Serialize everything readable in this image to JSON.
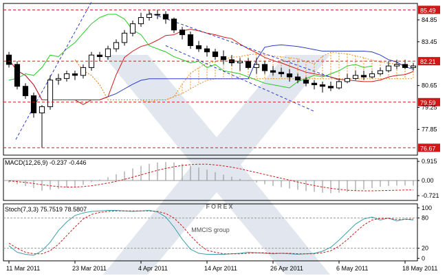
{
  "watermark": {
    "brand": "FOREX",
    "sub": "MMCIS group",
    "color": "#c8d2e2"
  },
  "colors": {
    "bull_candle": "#ffffff",
    "bear_candle": "#000000",
    "kijun": "#d01818",
    "tenkan": "#2a3cc8",
    "chikou": "#22cc22",
    "cloud": "#e88a1a",
    "cloud_bear": "#9a9a9a",
    "trend": "#2a3cc8",
    "level": "#d01818",
    "level_label_bg": "#d01818",
    "macd_hist": "#8c8c8c",
    "macd_signal": "#d01818",
    "stoch_main": "#3aa0a8",
    "stoch_signal": "#d01818"
  },
  "chart_data": [
    {
      "type": "candlestick",
      "panel": "price",
      "x": [
        "11 Mar 2011",
        "14 Mar 2011",
        "15 Mar 2011",
        "16 Mar 2011",
        "17 Mar 2011",
        "18 Mar 2011",
        "21 Mar 2011",
        "22 Mar 2011",
        "23 Mar 2011",
        "24 Mar 2011",
        "25 Mar 2011",
        "28 Mar 2011",
        "29 Mar 2011",
        "30 Mar 2011",
        "31 Mar 2011",
        "1 Apr 2011",
        "4 Apr 2011",
        "5 Apr 2011",
        "6 Apr 2011",
        "7 Apr 2011",
        "8 Apr 2011",
        "11 Apr 2011",
        "12 Apr 2011",
        "13 Apr 2011",
        "14 Apr 2011",
        "15 Apr 2011",
        "18 Apr 2011",
        "19 Apr 2011",
        "20 Apr 2011",
        "21 Apr 2011",
        "22 Apr 2011",
        "25 Apr 2011",
        "26 Apr 2011",
        "27 Apr 2011",
        "28 Apr 2011",
        "29 Apr 2011",
        "2 May 2011",
        "3 May 2011",
        "4 May 2011",
        "5 May 2011",
        "6 May 2011",
        "9 May 2011",
        "10 May 2011",
        "11 May 2011",
        "12 May 2011",
        "13 May 2011",
        "16 May 2011",
        "17 May 2011",
        "18 May 2011",
        "19 May 2011"
      ],
      "open": [
        82.6,
        82.0,
        80.6,
        80.0,
        78.9,
        79.3,
        81.0,
        81.1,
        81.4,
        81.3,
        81.8,
        82.6,
        82.5,
        83.0,
        83.4,
        84.0,
        84.6,
        85.0,
        85.2,
        85.2,
        84.9,
        84.2,
        83.9,
        83.2,
        83.0,
        82.8,
        82.5,
        82.3,
        82.1,
        82.2,
        81.8,
        82.0,
        81.6,
        81.5,
        81.4,
        81.2,
        81.0,
        80.8,
        80.7,
        80.6,
        80.5,
        80.9,
        81.1,
        81.3,
        81.2,
        81.4,
        81.6,
        81.9,
        82.0,
        81.8
      ],
      "high": [
        82.8,
        82.2,
        80.8,
        80.2,
        79.4,
        81.3,
        81.4,
        81.6,
        81.6,
        82.0,
        82.8,
        82.8,
        83.2,
        83.6,
        84.2,
        84.8,
        85.3,
        85.49,
        85.5,
        85.4,
        85.0,
        84.4,
        84.1,
        83.5,
        83.2,
        83.0,
        82.9,
        82.6,
        82.4,
        82.4,
        82.4,
        82.2,
        81.9,
        81.8,
        81.7,
        81.4,
        81.2,
        81.0,
        80.9,
        80.9,
        81.1,
        81.4,
        81.6,
        81.6,
        81.6,
        81.8,
        82.2,
        82.3,
        82.3,
        82.1
      ],
      "low": [
        81.8,
        80.4,
        79.8,
        78.6,
        76.67,
        79.1,
        80.7,
        80.9,
        81.0,
        81.1,
        81.6,
        82.2,
        82.3,
        82.8,
        83.2,
        83.8,
        84.4,
        84.8,
        84.9,
        84.6,
        84.0,
        83.6,
        83.0,
        82.8,
        82.5,
        82.3,
        82.0,
        81.9,
        81.6,
        81.7,
        81.4,
        81.4,
        81.3,
        81.2,
        80.9,
        80.8,
        80.6,
        80.4,
        80.2,
        80.3,
        80.4,
        80.8,
        81.0,
        81.0,
        81.1,
        81.3,
        81.5,
        81.7,
        81.7,
        81.6
      ],
      "close": [
        82.0,
        80.6,
        80.0,
        78.9,
        79.3,
        81.0,
        81.1,
        81.4,
        81.3,
        81.8,
        82.6,
        82.5,
        83.0,
        83.4,
        84.0,
        84.6,
        85.0,
        85.2,
        85.2,
        84.9,
        84.2,
        83.9,
        83.2,
        83.0,
        82.8,
        82.5,
        82.3,
        82.1,
        82.2,
        81.8,
        82.0,
        81.6,
        81.5,
        81.4,
        81.2,
        81.0,
        80.8,
        80.7,
        80.6,
        80.5,
        80.9,
        81.1,
        81.3,
        81.2,
        81.4,
        81.6,
        81.9,
        82.0,
        81.8,
        81.9
      ],
      "ylim": [
        76.2,
        85.9
      ],
      "y_ticks": [
        "84.85",
        "83.45",
        "82.21",
        "80.65",
        "79.25",
        "77.85"
      ],
      "y_tick_values": [
        84.85,
        83.45,
        82.21,
        80.65,
        79.25,
        77.85
      ],
      "levels": [
        {
          "value": 85.49,
          "label": "85.49"
        },
        {
          "value": 82.21,
          "label": "82.21"
        },
        {
          "value": 79.59,
          "label": "79.59"
        },
        {
          "value": 76.67,
          "label": "76.67"
        }
      ],
      "x_ticks": [
        "11 Mar 2011",
        "23 Mar 2011",
        "4 Apr 2011",
        "14 Apr 2011",
        "26 Apr 2011",
        "6 May 2011",
        "18 May 2011"
      ],
      "x_tick_index": [
        0,
        8,
        16,
        24,
        32,
        40,
        48
      ]
    },
    {
      "type": "line",
      "panel": "macd",
      "title": "MACD(12,26,9) -0.237 -0.446",
      "ylim": [
        -0.95,
        1.05
      ],
      "y_ticks": [
        "0.915",
        "0.00",
        "-0.721"
      ],
      "y_tick_values": [
        0.915,
        0.0,
        -0.721
      ],
      "histogram": [
        -0.1,
        -0.18,
        -0.26,
        -0.36,
        -0.48,
        -0.44,
        -0.4,
        -0.34,
        -0.28,
        -0.2,
        -0.08,
        0.04,
        0.16,
        0.3,
        0.44,
        0.58,
        0.7,
        0.8,
        0.86,
        0.88,
        0.86,
        0.8,
        0.72,
        0.62,
        0.52,
        0.4,
        0.28,
        0.18,
        0.08,
        -0.02,
        -0.1,
        -0.18,
        -0.26,
        -0.32,
        -0.38,
        -0.44,
        -0.5,
        -0.54,
        -0.58,
        -0.6,
        -0.58,
        -0.54,
        -0.48,
        -0.42,
        -0.36,
        -0.3,
        -0.26,
        -0.24,
        -0.24,
        -0.24
      ],
      "signal": [
        -0.02,
        -0.05,
        -0.09,
        -0.14,
        -0.2,
        -0.25,
        -0.29,
        -0.31,
        -0.31,
        -0.29,
        -0.25,
        -0.19,
        -0.12,
        -0.04,
        0.06,
        0.16,
        0.27,
        0.38,
        0.49,
        0.58,
        0.66,
        0.72,
        0.76,
        0.78,
        0.78,
        0.75,
        0.7,
        0.64,
        0.56,
        0.47,
        0.38,
        0.29,
        0.2,
        0.11,
        0.02,
        -0.07,
        -0.16,
        -0.24,
        -0.31,
        -0.37,
        -0.42,
        -0.46,
        -0.48,
        -0.49,
        -0.49,
        -0.48,
        -0.47,
        -0.46,
        -0.45,
        -0.45
      ]
    },
    {
      "type": "line",
      "panel": "stochastic",
      "title": "Stoch(7,3,3) 75.7519 78.5807",
      "ylim": [
        -5,
        108
      ],
      "y_ticks": [
        "100",
        "80",
        "20",
        "0"
      ],
      "y_tick_values": [
        100,
        80,
        20,
        0
      ],
      "levels": [
        80,
        20
      ],
      "main": [
        25,
        12,
        8,
        6,
        15,
        32,
        55,
        72,
        85,
        90,
        93,
        94,
        95,
        95,
        94,
        93,
        94,
        95,
        92,
        82,
        62,
        38,
        18,
        10,
        8,
        8,
        8,
        9,
        10,
        12,
        11,
        10,
        9,
        10,
        9,
        8,
        9,
        10,
        14,
        22,
        36,
        52,
        68,
        78,
        82,
        76,
        80,
        74,
        78,
        76
      ],
      "signal": [
        30,
        20,
        12,
        9,
        9,
        15,
        28,
        45,
        62,
        78,
        87,
        91,
        93,
        94,
        94,
        94,
        94,
        94,
        93,
        89,
        80,
        64,
        45,
        28,
        16,
        12,
        9,
        9,
        9,
        10,
        11,
        11,
        10,
        10,
        10,
        9,
        9,
        9,
        11,
        15,
        24,
        37,
        52,
        66,
        76,
        79,
        79,
        77,
        77,
        78
      ]
    }
  ]
}
